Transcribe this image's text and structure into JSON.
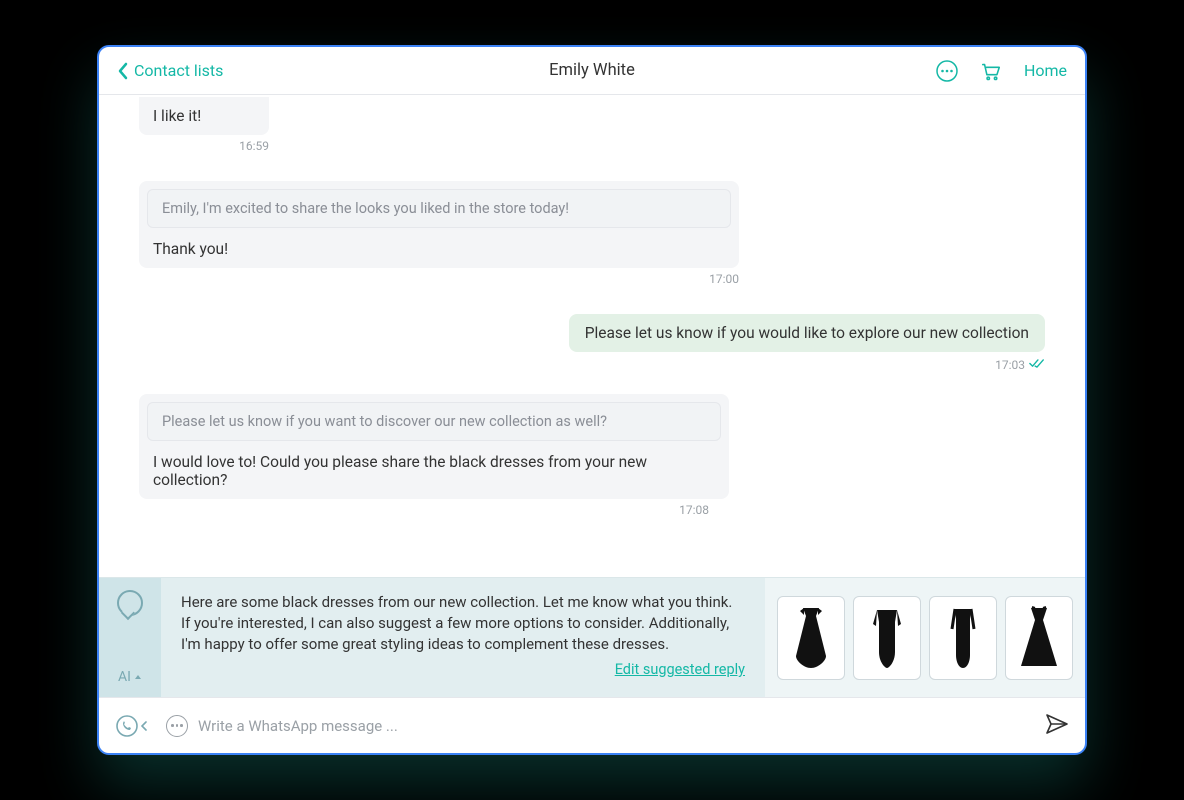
{
  "header": {
    "back_label": "Contact lists",
    "title": "Emily White",
    "home_label": "Home"
  },
  "chat": {
    "m1_text": "I like it!",
    "m1_time": "16:59",
    "m2_quote": "Emily, I'm excited to share the looks you liked in the store today!",
    "m2_text": "Thank you!",
    "m2_time": "17:00",
    "m3_text": "Please let us know if you would like to explore our new collection",
    "m3_time": "17:03",
    "m4_quote": "Please let us know if you want to discover our new collection as well?",
    "m4_text": "I would love to! Could you please share the black dresses from your new collection?",
    "m4_time": "17:08"
  },
  "ai": {
    "label": "AI",
    "suggested": "Here are some black dresses from our new collection. Let me know what you think. If you're interested, I can also suggest a few more options to consider. Additionally, I'm happy to offer some great styling ideas to complement these dresses.",
    "edit_label": "Edit suggested reply"
  },
  "input": {
    "placeholder": "Write a WhatsApp message ..."
  }
}
